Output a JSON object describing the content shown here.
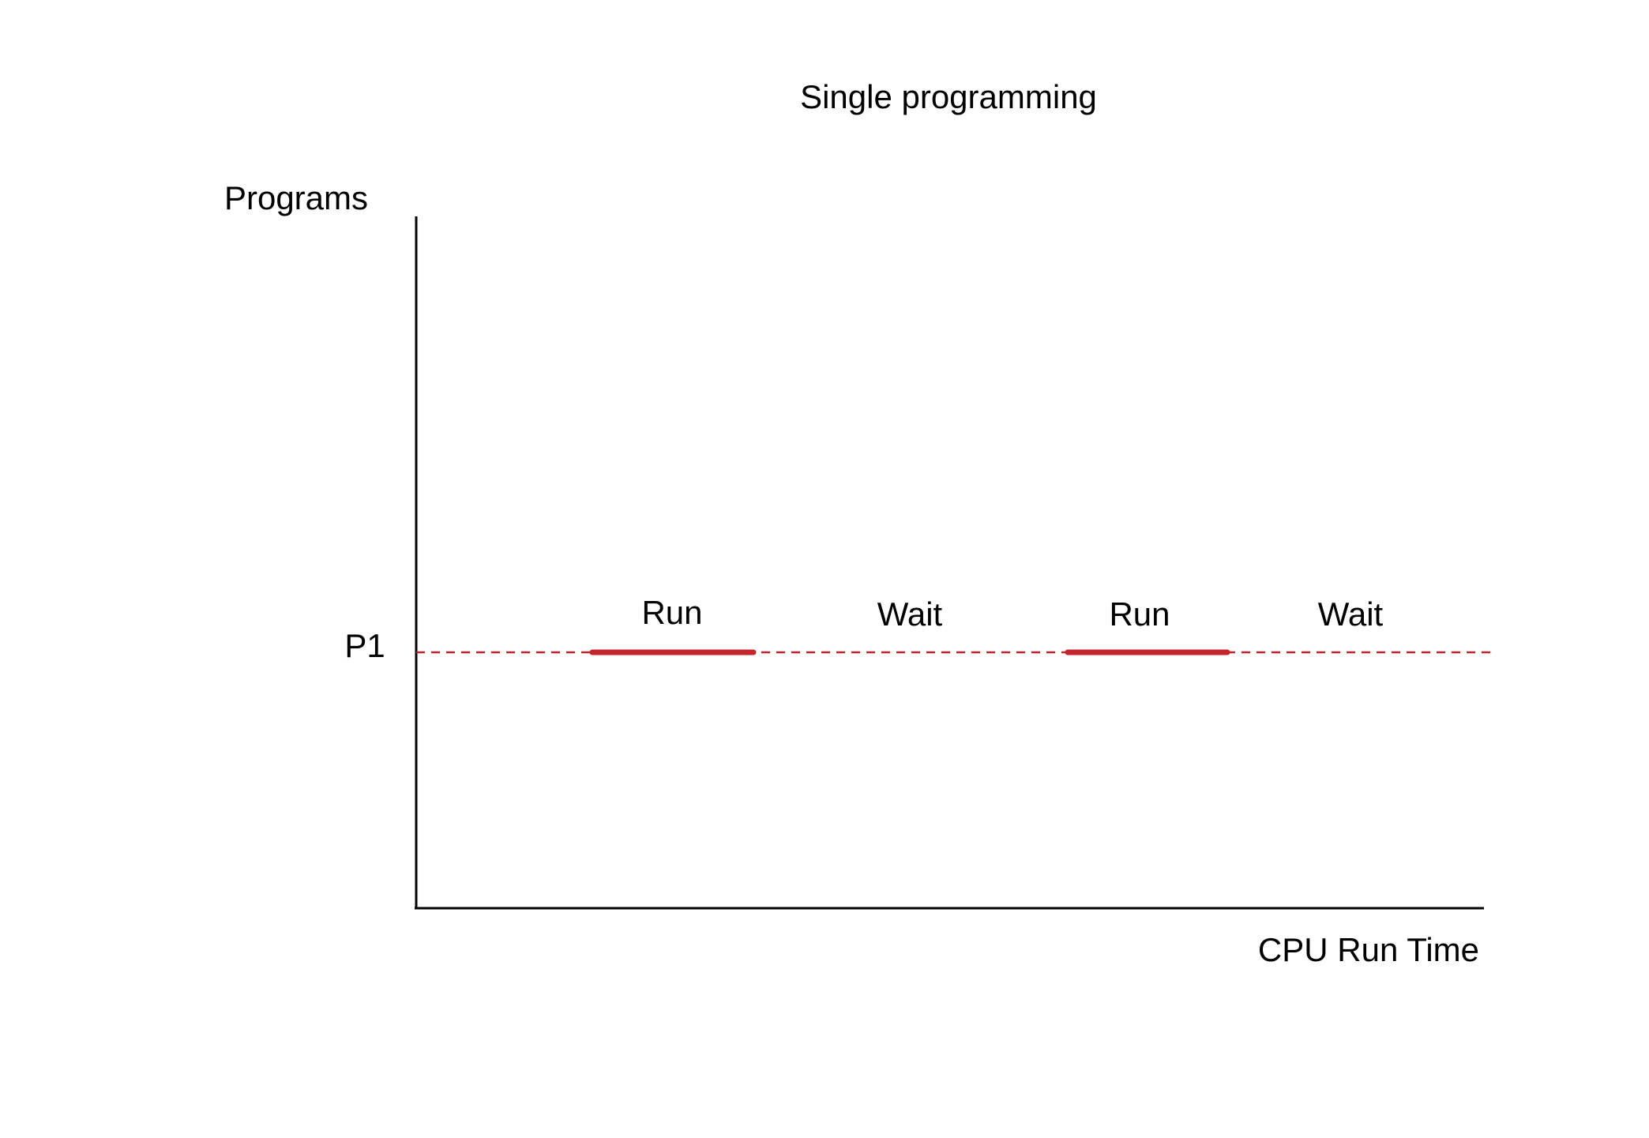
{
  "title": "Single programming",
  "y_axis_label": "Programs",
  "x_axis_label": "CPU Run Time",
  "colors": {
    "axis": "#000000",
    "text": "#000000",
    "program_line": "#c4242b"
  },
  "programs": [
    {
      "label": "P1",
      "segments": [
        {
          "state": "Run",
          "label": "Run"
        },
        {
          "state": "Wait",
          "label": "Wait"
        },
        {
          "state": "Run",
          "label": "Run"
        },
        {
          "state": "Wait",
          "label": "Wait"
        }
      ]
    }
  ]
}
